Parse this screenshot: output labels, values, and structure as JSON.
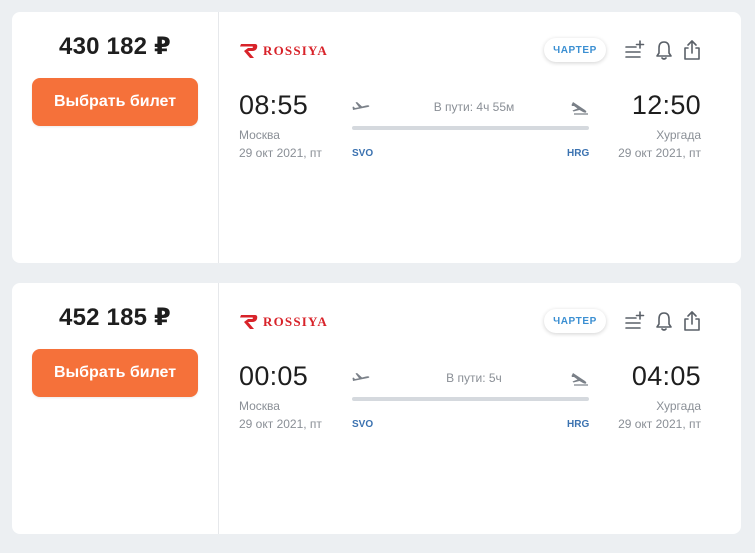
{
  "offers": [
    {
      "price": "430 182 ₽",
      "buy_label": "Выбрать билет",
      "airline": "ROSSIYA",
      "charter_badge": "ЧАРТЕР",
      "departure": {
        "time": "08:55",
        "city": "Москва",
        "date": "29 окт 2021, пт",
        "iata": "SVO"
      },
      "duration": "В пути: 4ч 55м",
      "arrival": {
        "time": "12:50",
        "city": "Хургада",
        "date": "29 окт 2021, пт",
        "iata": "HRG"
      }
    },
    {
      "price": "452 185 ₽",
      "buy_label": "Выбрать билет",
      "airline": "ROSSIYA",
      "charter_badge": "ЧАРТЕР",
      "departure": {
        "time": "00:05",
        "city": "Москва",
        "date": "29 окт 2021, пт",
        "iata": "SVO"
      },
      "duration": "В пути: 5ч",
      "arrival": {
        "time": "04:05",
        "city": "Хургада",
        "date": "29 окт 2021, пт",
        "iata": "HRG"
      }
    }
  ],
  "icons": {
    "airline_logo": "rossiya-logo-icon",
    "compare": "add-to-list-icon",
    "subscribe": "bell-icon",
    "share": "share-icon",
    "takeoff": "plane-takeoff-icon",
    "landing": "plane-landing-icon"
  },
  "colors": {
    "accent_button": "#f5713a",
    "airline_red": "#d8232a",
    "charter_blue": "#3b8fd2",
    "iata_blue": "#3b72b0"
  }
}
